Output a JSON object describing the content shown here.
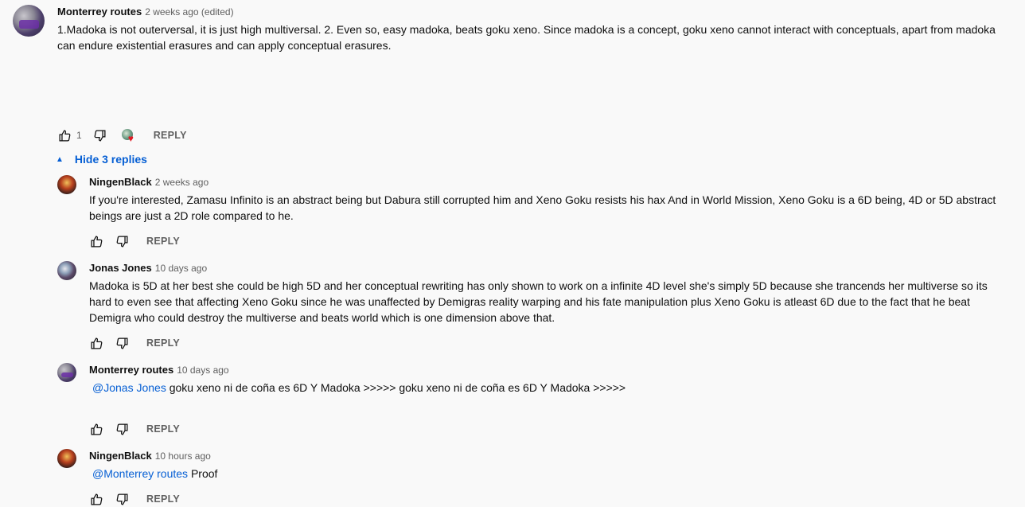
{
  "top_comment": {
    "author": "Monterrey routes",
    "time": "2 weeks ago (edited)",
    "text": "1.Madoka is not outerversal, it is just high multiversal. 2. Even so, easy madoka, beats goku xeno. Since madoka is a concept, goku xeno cannot interact with conceptuals, apart from madoka can endure existential erasures and can apply conceptual erasures.",
    "likes": "1",
    "reply_label": "REPLY",
    "hearted": true
  },
  "hide_replies_label": "Hide 3 replies",
  "replies": [
    {
      "author": "NingenBlack",
      "time": "2 weeks ago",
      "mention": "",
      "text": "If you're interested, Zamasu Infinito is an abstract being but Dabura still corrupted him and Xeno Goku resists his hax And in World Mission, Xeno Goku is a 6D being, 4D or 5D abstract beings are just a 2D role compared to he.",
      "reply_label": "REPLY"
    },
    {
      "author": "Jonas Jones",
      "time": "10 days ago",
      "mention": "",
      "text": "Madoka is 5D at her best she could be high 5D and her conceptual rewriting has only shown to work on a infinite 4D level she's simply 5D because she trancends her multiverse so its hard to even see that affecting Xeno Goku since he was unaffected by Demigras reality warping and his fate manipulation plus Xeno Goku is atleast 6D due to the fact that he beat Demigra who could destroy the multiverse and beats world which is one dimension above that.",
      "reply_label": "REPLY"
    },
    {
      "author": "Monterrey routes",
      "time": "10 days ago",
      "mention": "@Jonas Jones",
      "text": "goku xeno ni de coña es 6D Y Madoka >>>>> goku xeno ni de coña es 6D Y Madoka >>>>>",
      "reply_label": "REPLY"
    },
    {
      "author": "NingenBlack",
      "time": "10 hours ago",
      "mention": "@Monterrey routes",
      "text": "Proof",
      "reply_label": "REPLY"
    }
  ],
  "icons": {
    "like": "thumb-up-icon",
    "dislike": "thumb-down-icon",
    "heart": "heart-icon"
  },
  "colors": {
    "link": "#065fd4",
    "secondary_text": "#606060",
    "background": "#f9f9f9",
    "heart": "#e01b24"
  }
}
